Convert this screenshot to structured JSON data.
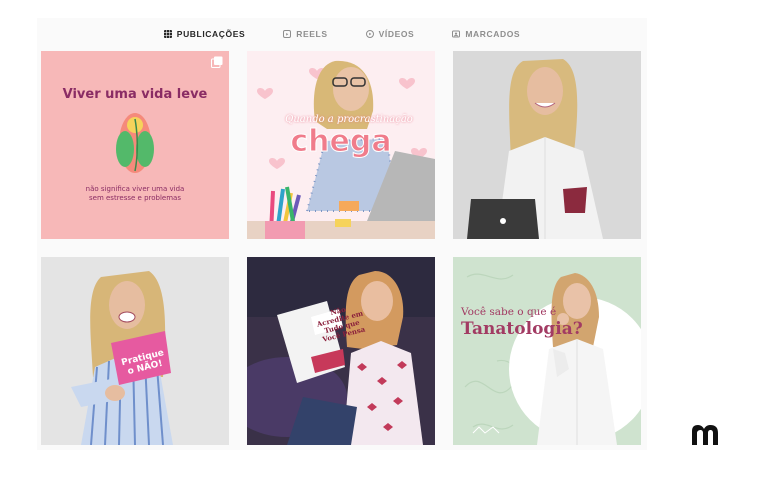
{
  "tabs": [
    {
      "label": "PUBLICAÇÕES",
      "icon": "grid-icon",
      "active": true
    },
    {
      "label": "REELS",
      "icon": "reels-icon",
      "active": false
    },
    {
      "label": "VÍDEOS",
      "icon": "play-icon",
      "active": false
    },
    {
      "label": "MARCADOS",
      "icon": "tagged-icon",
      "active": false
    }
  ],
  "posts": {
    "p1": {
      "title": "Viver uma vida leve",
      "subtitle": "não significa viver uma vida sem estresse e problemas",
      "icon": "multiple-photos-icon",
      "bg": "#f7b8b8"
    },
    "p2": {
      "small": "Quando a procrastinação",
      "title": "chega",
      "bg": "#fdeef1"
    },
    "p3": {
      "bg": "#d9d9d9"
    },
    "p4": {
      "sign": "Pratique o NÃO!",
      "bg": "#e4e4e4"
    },
    "p5": {
      "book": "Não Acredite em Tudo que Você Pensa",
      "bg": "#3a3148"
    },
    "p6": {
      "question": "Você sabe o que é",
      "title": "Tanatologia?",
      "bg": "#cfe3cf"
    }
  },
  "brand": {
    "icon": "brand-logo-icon",
    "color": "#111111"
  },
  "colors": {
    "active_tab": "#262626",
    "inactive_tab": "#8e8e8e",
    "accent": "#8a2c64"
  }
}
